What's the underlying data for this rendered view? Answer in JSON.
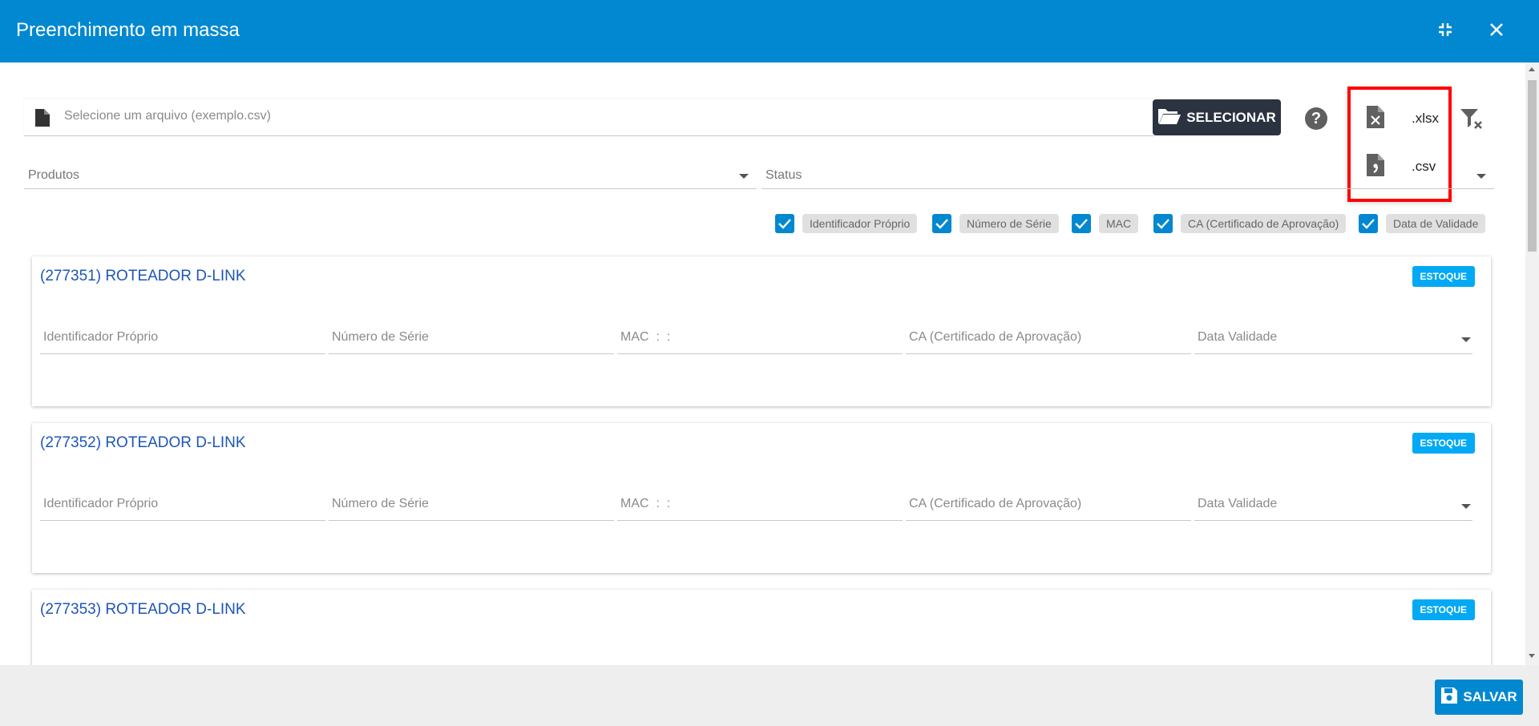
{
  "header": {
    "title": "Preenchimento em massa",
    "minimize_icon": "collapse-icon",
    "close_icon": "close-icon",
    "bg_color": "#0288d1"
  },
  "file_selector": {
    "placeholder": "Selecione um arquivo (exemplo.csv)",
    "button_label": "SELECIONAR"
  },
  "help": {
    "icon": "help-icon",
    "label": "?"
  },
  "export_menu": {
    "items": [
      {
        "label": ".xlsx",
        "icon": "xlsx-file-icon"
      },
      {
        "label": ".csv",
        "icon": "csv-file-icon"
      }
    ]
  },
  "filters": {
    "produtos_label": "Produtos",
    "status_label": "Status"
  },
  "columns": [
    {
      "label": "Identificador Próprio",
      "checked": true
    },
    {
      "label": "Número de Série",
      "checked": true
    },
    {
      "label": "MAC",
      "checked": true
    },
    {
      "label": "CA (Certificado de Aprovação)",
      "checked": true
    },
    {
      "label": "Data de Validade",
      "checked": true
    }
  ],
  "field_placeholders": {
    "identificador": "Identificador Próprio",
    "serie": "Número de Série",
    "mac": "MAC  :  :",
    "ca": "CA (Certificado de Aprovação)",
    "validade": "Data Validade"
  },
  "products": [
    {
      "title": "(277351) ROTEADOR D-LINK",
      "badge": "ESTOQUE"
    },
    {
      "title": "(277352) ROTEADOR D-LINK",
      "badge": "ESTOQUE"
    },
    {
      "title": "(277353) ROTEADOR D-LINK",
      "badge": "ESTOQUE"
    }
  ],
  "footer": {
    "save_label": "SALVAR"
  },
  "colors": {
    "accent": "#0288d1",
    "badge": "#03a9f4",
    "title_link": "#1e55b8",
    "highlight": "#ff0000"
  }
}
